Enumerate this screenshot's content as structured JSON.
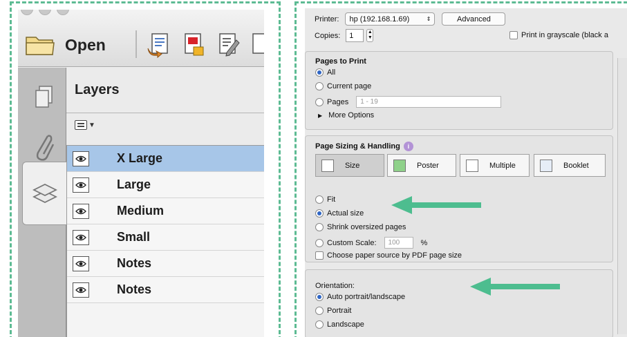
{
  "left": {
    "toolbar": {
      "open_label": "Open"
    },
    "layers_title": "Layers",
    "layers": [
      {
        "name": "X Large",
        "selected": true
      },
      {
        "name": "Large",
        "selected": false
      },
      {
        "name": "Medium",
        "selected": false
      },
      {
        "name": "Small",
        "selected": false
      },
      {
        "name": "Notes",
        "selected": false
      },
      {
        "name": "Notes",
        "selected": false
      }
    ]
  },
  "right": {
    "printer_label": "Printer:",
    "printer_value": "hp (192.168.1.69)",
    "advanced_button": "Advanced",
    "copies_label": "Copies:",
    "copies_value": "1",
    "grayscale_label": "Print in grayscale (black a",
    "pages_to_print": {
      "title": "Pages to Print",
      "all": "All",
      "current": "Current page",
      "pages": "Pages",
      "pages_placeholder": "1 - 19",
      "more": "More Options",
      "selected": "All"
    },
    "sizing": {
      "title": "Page Sizing & Handling",
      "modes": [
        "Size",
        "Poster",
        "Multiple",
        "Booklet"
      ],
      "fit": "Fit",
      "actual": "Actual size",
      "shrink": "Shrink oversized pages",
      "custom": "Custom Scale:",
      "custom_value": "100",
      "percent": "%",
      "paper_source": "Choose paper source by PDF page size",
      "selected": "Actual size"
    },
    "orientation": {
      "title": "Orientation:",
      "auto": "Auto portrait/landscape",
      "portrait": "Portrait",
      "landscape": "Landscape",
      "selected": "Auto portrait/landscape"
    }
  },
  "colors": {
    "accent_green": "#4dbd8f",
    "selection_blue": "#a7c6e8",
    "radio_blue": "#2f66c5"
  }
}
